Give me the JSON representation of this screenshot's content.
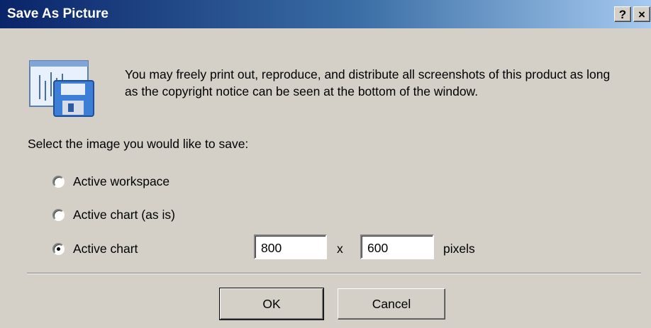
{
  "window": {
    "title": "Save As Picture",
    "help_label": "?",
    "close_label": "×"
  },
  "message": "You may freely print out, reproduce, and distribute all screenshots of this product as long as the copyright notice can be seen at the bottom of the window.",
  "prompt": "Select the image you would like to save:",
  "options": [
    {
      "label": "Active workspace",
      "checked": false
    },
    {
      "label": "Active chart (as is)",
      "checked": false
    },
    {
      "label": "Active chart",
      "checked": true
    }
  ],
  "size": {
    "width": "800",
    "times": "x",
    "height": "600",
    "unit": "pixels"
  },
  "buttons": {
    "ok": "OK",
    "cancel": "Cancel"
  },
  "colors": {
    "titlebar_start": "#0a246a",
    "titlebar_end": "#a6caf0",
    "dialog_bg": "#d4d0c8"
  }
}
